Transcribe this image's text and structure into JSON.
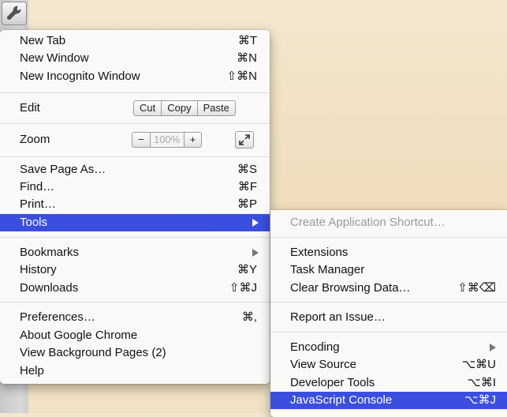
{
  "wrench_icon": "wrench-icon",
  "main_menu": {
    "new_tab": {
      "label": "New Tab",
      "shortcut": "⌘T"
    },
    "new_window": {
      "label": "New Window",
      "shortcut": "⌘N"
    },
    "new_incognito": {
      "label": "New Incognito Window",
      "shortcut": "⇧⌘N"
    },
    "edit": {
      "label": "Edit",
      "cut": "Cut",
      "copy": "Copy",
      "paste": "Paste"
    },
    "zoom": {
      "label": "Zoom",
      "minus": "−",
      "value": "100%",
      "plus": "+"
    },
    "save_page_as": {
      "label": "Save Page As…",
      "shortcut": "⌘S"
    },
    "find": {
      "label": "Find…",
      "shortcut": "⌘F"
    },
    "print": {
      "label": "Print…",
      "shortcut": "⌘P"
    },
    "tools": {
      "label": "Tools"
    },
    "bookmarks": {
      "label": "Bookmarks"
    },
    "history": {
      "label": "History",
      "shortcut": "⌘Y"
    },
    "downloads": {
      "label": "Downloads",
      "shortcut": "⇧⌘J"
    },
    "preferences": {
      "label": "Preferences…",
      "shortcut": "⌘,"
    },
    "about": {
      "label": "About Google Chrome"
    },
    "background_pages": {
      "label": "View Background Pages (2)"
    },
    "help": {
      "label": "Help"
    }
  },
  "tools_submenu": {
    "create_shortcut": {
      "label": "Create Application Shortcut…"
    },
    "extensions": {
      "label": "Extensions"
    },
    "task_manager": {
      "label": "Task Manager"
    },
    "clear_browsing": {
      "label": "Clear Browsing Data…",
      "shortcut": "⇧⌘⌫"
    },
    "report_issue": {
      "label": "Report an Issue…"
    },
    "encoding": {
      "label": "Encoding"
    },
    "view_source": {
      "label": "View Source",
      "shortcut": "⌥⌘U"
    },
    "developer_tools": {
      "label": "Developer Tools",
      "shortcut": "⌥⌘I"
    },
    "javascript_console": {
      "label": "JavaScript Console",
      "shortcut": "⌥⌘J"
    }
  },
  "colors": {
    "highlight": "#3a4fe0",
    "disabled_text": "#9a9a9a"
  }
}
